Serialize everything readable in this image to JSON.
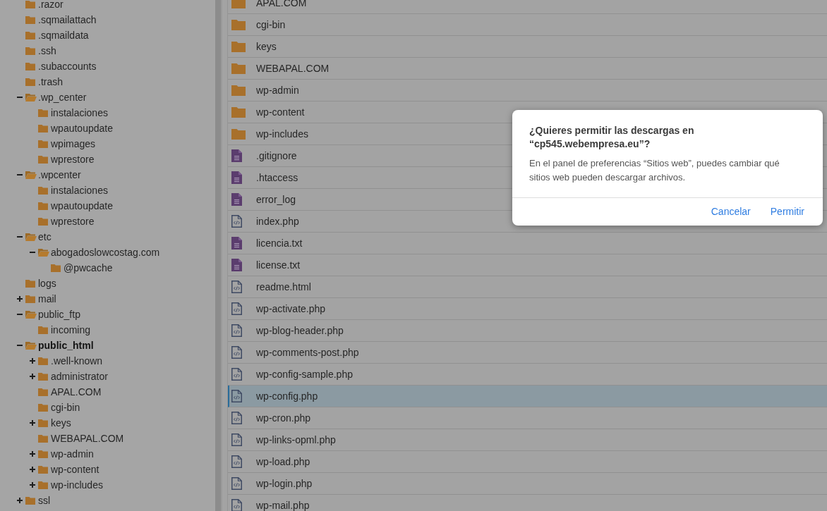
{
  "tree": [
    {
      "label": ".razor",
      "selected": false
    },
    {
      "label": ".sqmailattach",
      "selected": false
    },
    {
      "label": ".sqmaildata",
      "selected": false
    },
    {
      "label": ".ssh",
      "selected": false
    },
    {
      "label": ".subaccounts",
      "selected": false
    },
    {
      "label": ".trash",
      "selected": false
    },
    {
      "label": ".wp_center",
      "selected": false,
      "expanded": true,
      "children": [
        {
          "label": "instalaciones",
          "selected": false
        },
        {
          "label": "wpautoupdate",
          "selected": false
        },
        {
          "label": "wpimages",
          "selected": false
        },
        {
          "label": "wprestore",
          "selected": false
        }
      ]
    },
    {
      "label": ".wpcenter",
      "selected": false,
      "expanded": true,
      "children": [
        {
          "label": "instalaciones",
          "selected": false
        },
        {
          "label": "wpautoupdate",
          "selected": false
        },
        {
          "label": "wprestore",
          "selected": false
        }
      ]
    },
    {
      "label": "etc",
      "selected": false,
      "expanded": true,
      "children": [
        {
          "label": "abogadoslowcostag.com",
          "selected": false,
          "expanded": true,
          "children": [
            {
              "label": "@pwcache",
              "selected": false
            }
          ]
        }
      ]
    },
    {
      "label": "logs",
      "selected": false
    },
    {
      "label": "mail",
      "selected": false,
      "expanded": false
    },
    {
      "label": "public_ftp",
      "selected": false,
      "expanded": true,
      "children": [
        {
          "label": "incoming",
          "selected": false
        }
      ]
    },
    {
      "label": "public_html",
      "selected": true,
      "expanded": true,
      "children": [
        {
          "label": ".well-known",
          "selected": false,
          "expanded": false
        },
        {
          "label": "administrator",
          "selected": false,
          "expanded": false
        },
        {
          "label": "APAL.COM",
          "selected": false
        },
        {
          "label": "cgi-bin",
          "selected": false
        },
        {
          "label": "keys",
          "selected": false,
          "expanded": false
        },
        {
          "label": "WEBAPAL.COM",
          "selected": false
        },
        {
          "label": "wp-admin",
          "selected": false,
          "expanded": false
        },
        {
          "label": "wp-content",
          "selected": false,
          "expanded": false
        },
        {
          "label": "wp-includes",
          "selected": false,
          "expanded": false
        }
      ]
    },
    {
      "label": "ssl",
      "selected": false,
      "expanded": false
    }
  ],
  "files": [
    {
      "name": "APAL.COM",
      "kind": "folder",
      "selected": false
    },
    {
      "name": "cgi-bin",
      "kind": "folder",
      "selected": false
    },
    {
      "name": "keys",
      "kind": "folder",
      "selected": false
    },
    {
      "name": "WEBAPAL.COM",
      "kind": "folder",
      "selected": false
    },
    {
      "name": "wp-admin",
      "kind": "folder",
      "selected": false
    },
    {
      "name": "wp-content",
      "kind": "folder",
      "selected": false
    },
    {
      "name": "wp-includes",
      "kind": "folder",
      "selected": false
    },
    {
      "name": ".gitignore",
      "kind": "text",
      "selected": false
    },
    {
      "name": ".htaccess",
      "kind": "text",
      "selected": false
    },
    {
      "name": "error_log",
      "kind": "text",
      "selected": false
    },
    {
      "name": "index.php",
      "kind": "code",
      "selected": false
    },
    {
      "name": "licencia.txt",
      "kind": "text",
      "selected": false
    },
    {
      "name": "license.txt",
      "kind": "text",
      "selected": false
    },
    {
      "name": "readme.html",
      "kind": "code",
      "selected": false
    },
    {
      "name": "wp-activate.php",
      "kind": "code",
      "selected": false
    },
    {
      "name": "wp-blog-header.php",
      "kind": "code",
      "selected": false
    },
    {
      "name": "wp-comments-post.php",
      "kind": "code",
      "selected": false
    },
    {
      "name": "wp-config-sample.php",
      "kind": "code",
      "selected": false
    },
    {
      "name": "wp-config.php",
      "kind": "code",
      "selected": true
    },
    {
      "name": "wp-cron.php",
      "kind": "code",
      "selected": false
    },
    {
      "name": "wp-links-opml.php",
      "kind": "code",
      "selected": false
    },
    {
      "name": "wp-load.php",
      "kind": "code",
      "selected": false
    },
    {
      "name": "wp-login.php",
      "kind": "code",
      "selected": false
    },
    {
      "name": "wp-mail.php",
      "kind": "code",
      "selected": false
    }
  ],
  "dialog": {
    "title": "¿Quieres permitir las descargas en “cp545.webempresa.eu”?",
    "message": "En el panel de preferencias “Sitios web”, puedes cambiar qué sitios web pueden descargar archivos.",
    "buttons": [
      "Cancelar",
      "Permitir"
    ]
  }
}
